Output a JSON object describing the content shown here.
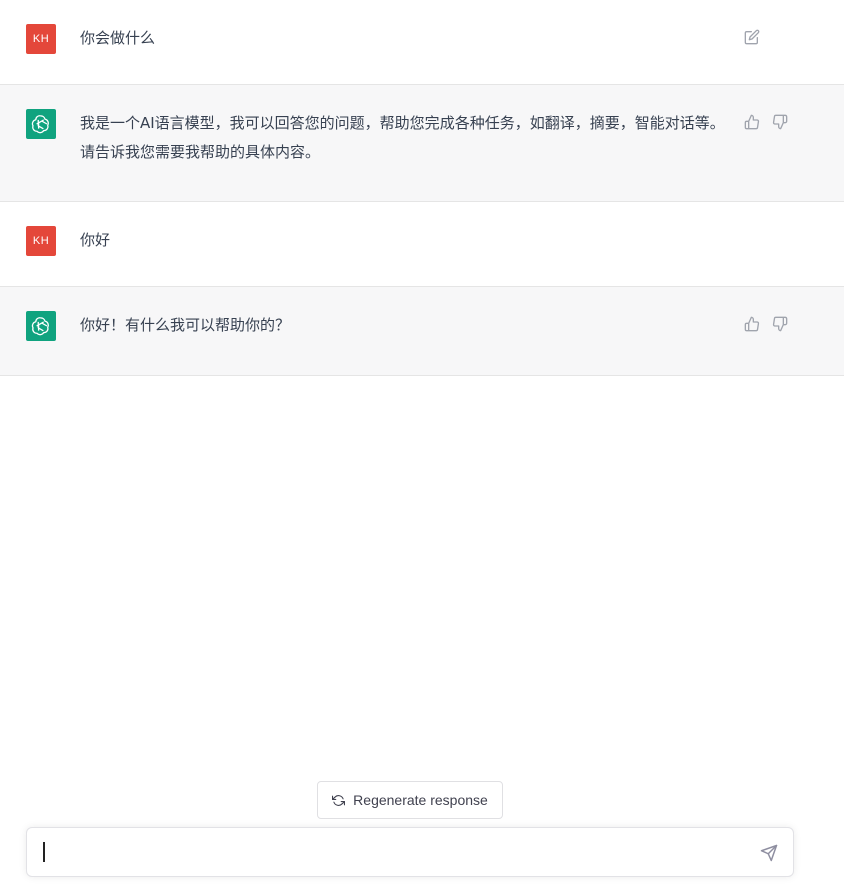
{
  "conversation": {
    "messages": [
      {
        "role": "user",
        "avatar_text": "KH",
        "text": "你会做什么"
      },
      {
        "role": "assistant",
        "text": "我是一个AI语言模型，我可以回答您的问题，帮助您完成各种任务，如翻译，摘要，智能对话等。请告诉我您需要我帮助的具体内容。"
      },
      {
        "role": "user",
        "avatar_text": "KH",
        "text": "你好"
      },
      {
        "role": "assistant",
        "text": "你好！有什么我可以帮助你的？"
      }
    ]
  },
  "regenerate": {
    "label": "Regenerate response"
  },
  "composer": {
    "value": "",
    "placeholder": ""
  },
  "icons": {
    "edit": "edit-icon",
    "thumbs_up": "thumbs-up-icon",
    "thumbs_down": "thumbs-down-icon",
    "refresh": "refresh-icon",
    "send": "send-icon",
    "assistant_logo": "openai-logo-icon"
  },
  "colors": {
    "user_avatar": "#e4473a",
    "assistant_avatar": "#10a37f",
    "assistant_bg": "#f7f7f8"
  }
}
